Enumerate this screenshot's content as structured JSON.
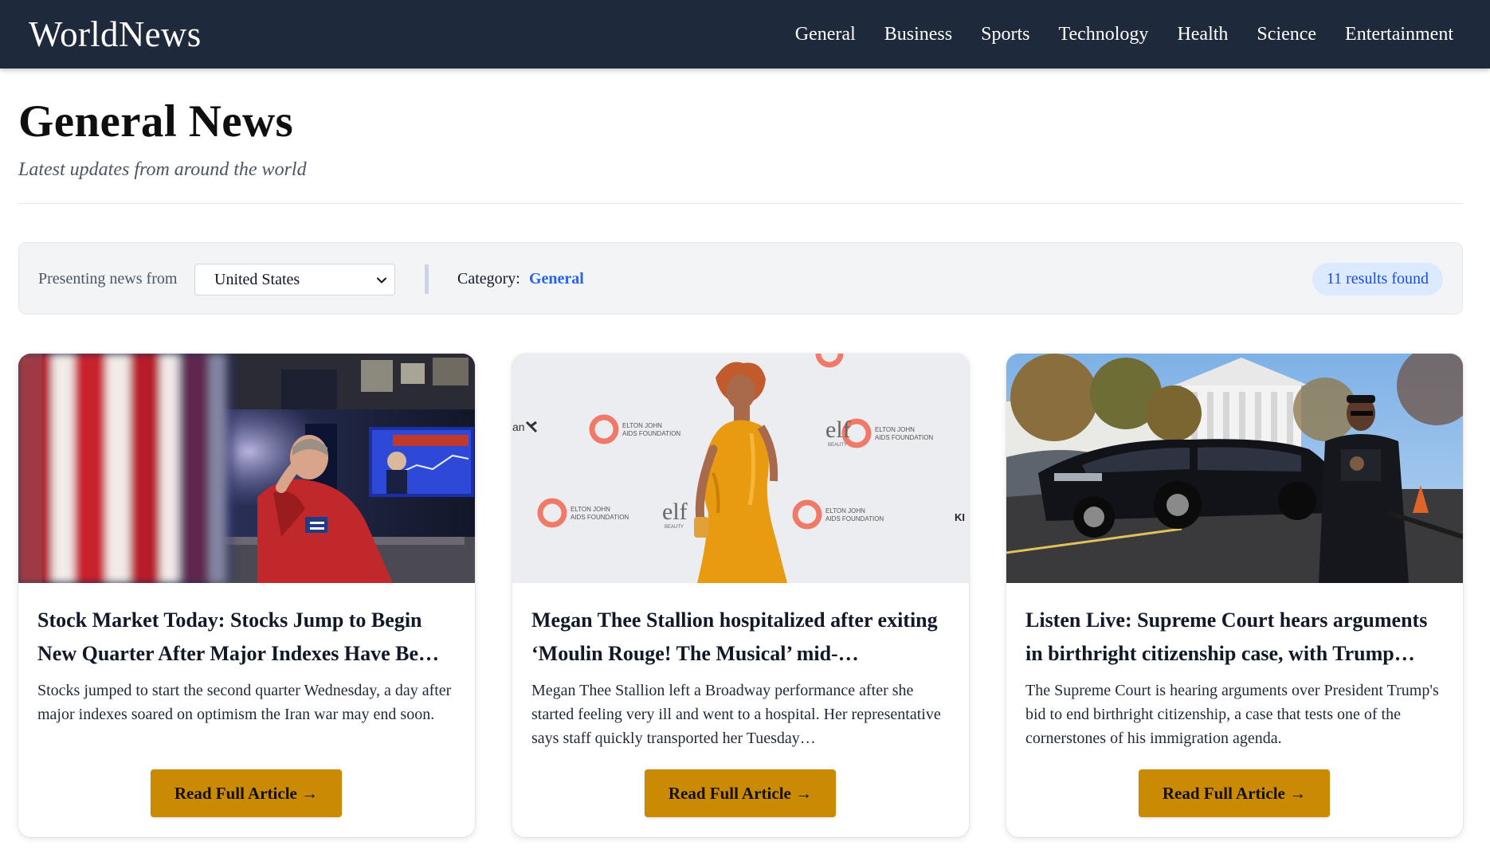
{
  "site": {
    "brand": "WorldNews",
    "nav": [
      "General",
      "Business",
      "Sports",
      "Technology",
      "Health",
      "Science",
      "Entertainment"
    ]
  },
  "header": {
    "title": "General News",
    "subtitle": "Latest updates from around the world"
  },
  "filters": {
    "label": "Presenting news from",
    "country_selected": "United States",
    "category_label": "Category:",
    "category_value": "General",
    "results": "11 results found"
  },
  "colors": {
    "navbar": "#1e293b",
    "accent_button": "#ca8a04",
    "link_blue": "#2563eb",
    "badge_bg": "#dbeafe"
  },
  "articles": [
    {
      "title": "Stock Market Today: Stocks Jump to Begin New Quarter After Major Indexes Have Be…",
      "description": "Stocks jumped to start the second quarter Wednesday, a day after major indexes soared on optimism the Iran war may end soon.",
      "button": "Read Full Article →",
      "image": "trader-with-flag-photo"
    },
    {
      "title": "Megan Thee Stallion hospitalized after exiting ‘Moulin Rouge! The Musical’ mid-…",
      "description": "Megan Thee Stallion left a Broadway performance after she started feeling very ill and went to a hospital. Her representative says staff quickly transported her Tuesday…",
      "button": "Read Full Article →",
      "image": "red-carpet-yellow-dress-photo",
      "image_text": {
        "foundation_line1": "ELTON JOHN",
        "foundation_line2": "AIDS FOUNDATION",
        "elf": "elf",
        "beauty": "BEAUTY",
        "partial_left": "an",
        "partial_right": "KI"
      }
    },
    {
      "title": "Listen Live: Supreme Court hears arguments in birthright citizenship case, with Trump…",
      "description": "The Supreme Court is hearing arguments over President Trump's bid to end birthright citizenship, a case that tests one of the cornerstones of his immigration agenda.",
      "button": "Read Full Article →",
      "image": "supreme-court-motorcade-photo"
    }
  ]
}
